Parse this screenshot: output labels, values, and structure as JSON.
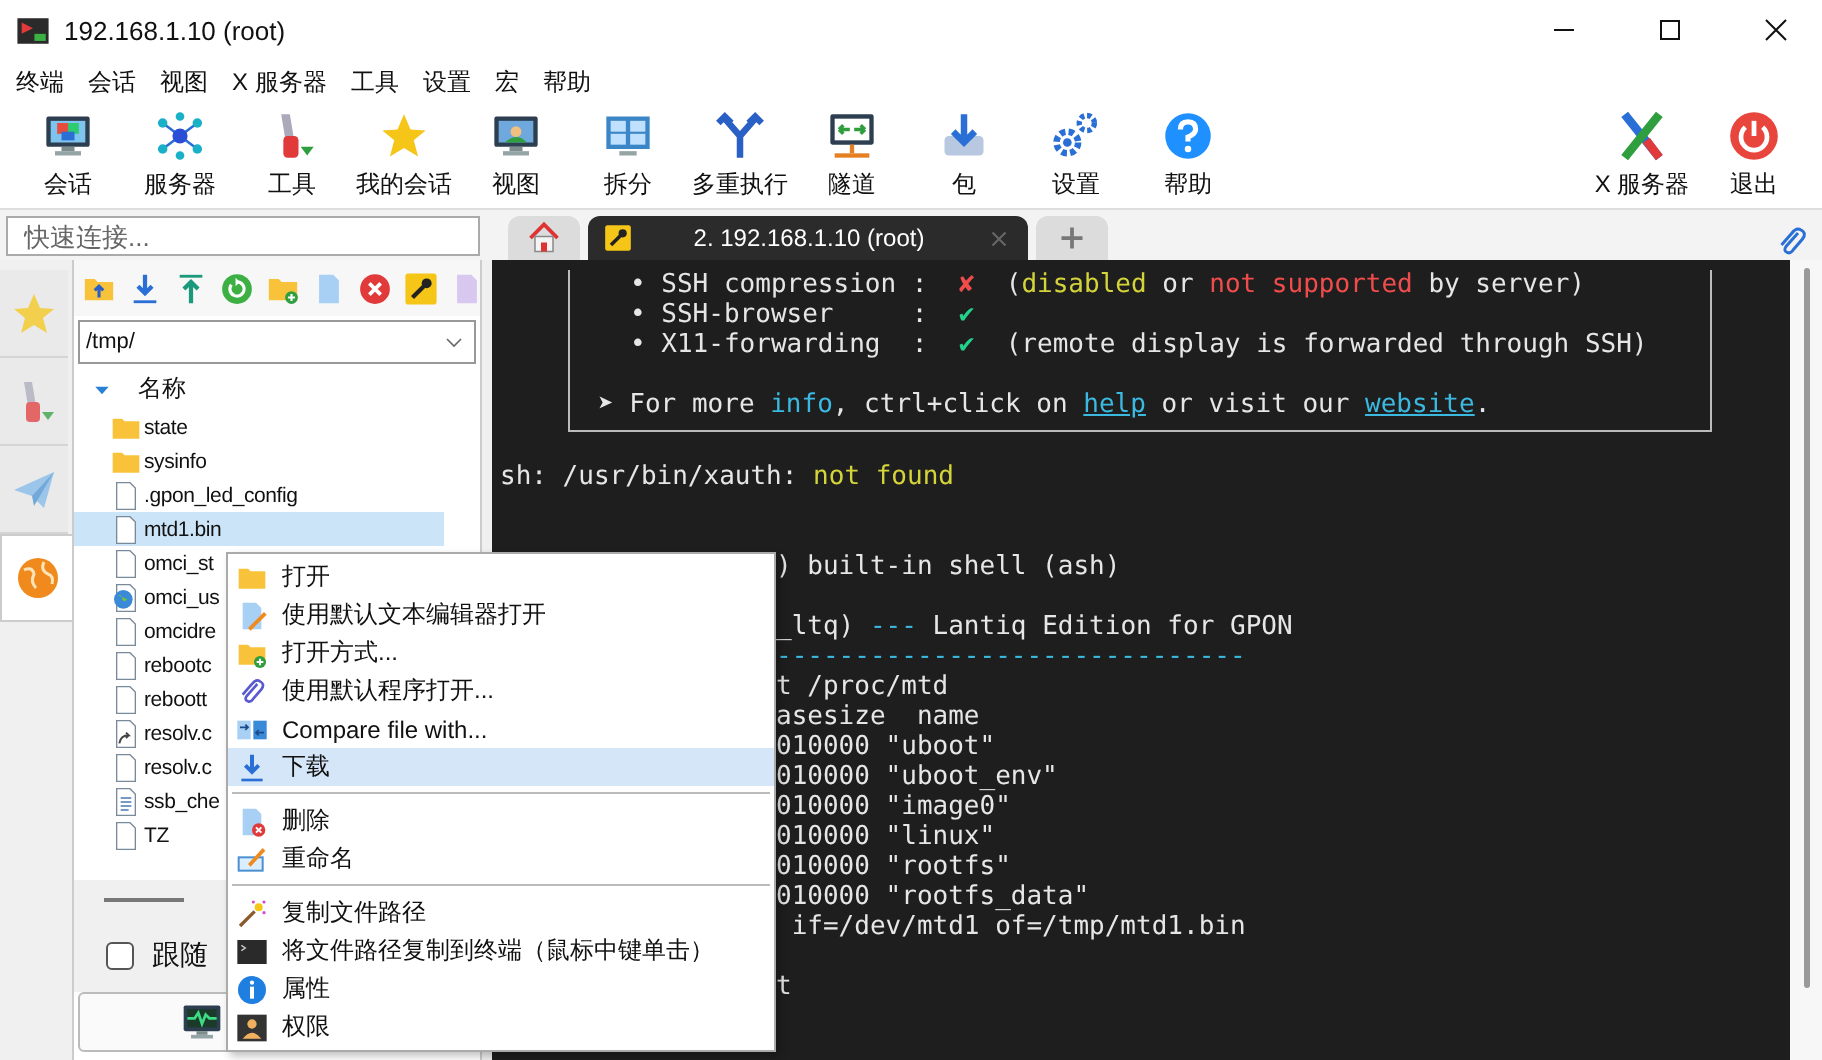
{
  "window": {
    "title": "192.168.1.10 (root)"
  },
  "menu_bar": [
    "终端",
    "会话",
    "视图",
    "X 服务器",
    "工具",
    "设置",
    "宏",
    "帮助"
  ],
  "toolbar": {
    "left": [
      {
        "kind": "session",
        "label": "会话"
      },
      {
        "kind": "servers",
        "label": "服务器"
      },
      {
        "kind": "tools",
        "label": "工具"
      },
      {
        "kind": "star",
        "label": "我的会话"
      },
      {
        "kind": "view",
        "label": "视图"
      },
      {
        "kind": "split",
        "label": "拆分"
      },
      {
        "kind": "fork",
        "label": "多重执行"
      },
      {
        "kind": "tunnel",
        "label": "隧道"
      },
      {
        "kind": "package",
        "label": "包"
      },
      {
        "kind": "settings",
        "label": "设置"
      },
      {
        "kind": "help",
        "label": "帮助"
      }
    ],
    "right": [
      {
        "kind": "xserver",
        "label": "X 服务器"
      },
      {
        "kind": "exit",
        "label": "退出"
      }
    ]
  },
  "quick_connect": {
    "placeholder": "快速连接..."
  },
  "tabs": [
    {
      "kind": "home",
      "selected": false
    },
    {
      "kind": "session",
      "label": "2. 192.168.1.10 (root)",
      "selected": true
    },
    {
      "kind": "new",
      "selected": false
    }
  ],
  "side_tabs": [
    {
      "kind": "star",
      "selected": false
    },
    {
      "kind": "tools",
      "selected": false
    },
    {
      "kind": "send",
      "selected": false
    },
    {
      "kind": "globe",
      "selected": true
    }
  ],
  "file_panel": {
    "toolbar": [
      {
        "kind": "folderup"
      },
      {
        "kind": "download"
      },
      {
        "kind": "upload"
      },
      {
        "kind": "refresh"
      },
      {
        "kind": "newfolder"
      },
      {
        "kind": "newfile"
      },
      {
        "kind": "delete"
      },
      {
        "kind": "key"
      },
      {
        "kind": "page"
      }
    ],
    "path": "/tmp/",
    "header": {
      "label": "名称",
      "expanded": true
    },
    "files": [
      {
        "name": "state",
        "kind": "folder",
        "selected": false
      },
      {
        "name": "sysinfo",
        "kind": "folder",
        "selected": false
      },
      {
        "name": ".gpon_led_config",
        "kind": "file",
        "selected": false
      },
      {
        "name": "mtd1.bin",
        "kind": "file",
        "selected": true
      },
      {
        "name": "omci_st",
        "kind": "file",
        "selected": false
      },
      {
        "name": "omci_us",
        "kind": "web",
        "selected": false
      },
      {
        "name": "omcidre",
        "kind": "file",
        "selected": false
      },
      {
        "name": "rebootc",
        "kind": "file",
        "selected": false
      },
      {
        "name": "reboott",
        "kind": "file",
        "selected": false
      },
      {
        "name": "resolv.c",
        "kind": "shortcut",
        "selected": false
      },
      {
        "name": "resolv.c",
        "kind": "file",
        "selected": false
      },
      {
        "name": "ssb_che",
        "kind": "text",
        "selected": false
      },
      {
        "name": "TZ",
        "kind": "file",
        "selected": false
      }
    ],
    "follow": {
      "label": "跟随",
      "checked": false
    }
  },
  "context_menu": {
    "sections": [
      [
        {
          "kind": "open",
          "label": "打开",
          "selected": false
        },
        {
          "kind": "editor",
          "label": "使用默认文本编辑器打开",
          "selected": false
        },
        {
          "kind": "openwith",
          "label": "打开方式...",
          "selected": false
        },
        {
          "kind": "default",
          "label": "使用默认程序打开...",
          "selected": false
        },
        {
          "kind": "compare",
          "label": "Compare file with...",
          "selected": false
        },
        {
          "kind": "download",
          "label": "下载",
          "selected": true
        }
      ],
      [
        {
          "kind": "delete",
          "label": "删除",
          "selected": false
        },
        {
          "kind": "rename",
          "label": "重命名",
          "selected": false
        }
      ],
      [
        {
          "kind": "copypath",
          "label": "复制文件路径",
          "selected": false
        },
        {
          "kind": "copyterm",
          "label": "将文件路径复制到终端（鼠标中键单击）",
          "selected": false
        },
        {
          "kind": "props",
          "label": "属性",
          "selected": false
        },
        {
          "kind": "perms",
          "label": "权限",
          "selected": false
        }
      ]
    ]
  },
  "terminal": {
    "banner": [
      {
        "kind": "bullet",
        "segments": [
          {
            "kind": "text",
            "text": "• SSH compression :  "
          },
          {
            "kind": "error",
            "text": "✘"
          },
          {
            "kind": "text",
            "text": "  ("
          },
          {
            "kind": "warn",
            "text": "disabled"
          },
          {
            "kind": "text",
            "text": " or "
          },
          {
            "kind": "error",
            "text": "not supported"
          },
          {
            "kind": "text",
            "text": " by server)"
          }
        ]
      },
      {
        "kind": "bullet",
        "segments": [
          {
            "kind": "text",
            "text": "• SSH-browser     :  "
          },
          {
            "kind": "ok",
            "text": "✔"
          }
        ]
      },
      {
        "kind": "bullet",
        "segments": [
          {
            "kind": "text",
            "text": "• X11-forwarding  :  "
          },
          {
            "kind": "ok",
            "text": "✔"
          },
          {
            "kind": "text",
            "text": "  (remote display is forwarded through SSH)"
          }
        ]
      },
      {
        "kind": "blank"
      },
      {
        "kind": "note",
        "segments": [
          {
            "kind": "text",
            "text": "➤ For more "
          },
          {
            "kind": "info",
            "text": "info"
          },
          {
            "kind": "text",
            "text": ", ctrl+click on "
          },
          {
            "kind": "link",
            "text": "help"
          },
          {
            "kind": "text",
            "text": " or visit our "
          },
          {
            "kind": "link",
            "text": "website"
          },
          {
            "kind": "text",
            "text": "."
          }
        ]
      }
    ],
    "lines": [
      {
        "kind": "blank"
      },
      {
        "kind": "full",
        "segments": [
          {
            "kind": "text",
            "text": "sh: /usr/bin/xauth: "
          },
          {
            "kind": "warn",
            "text": "not found"
          }
        ]
      },
      {
        "kind": "blank"
      },
      {
        "kind": "blank"
      },
      {
        "kind": "partial",
        "segments": [
          {
            "kind": "text",
            "text": ") built-in shell (ash)"
          }
        ]
      },
      {
        "kind": "blank"
      },
      {
        "kind": "partial",
        "segments": [
          {
            "kind": "text",
            "text": "_ltq) "
          },
          {
            "kind": "info",
            "text": "---"
          },
          {
            "kind": "text",
            "text": " Lantiq Edition for GPON"
          }
        ]
      },
      {
        "kind": "partial",
        "segments": [
          {
            "kind": "info",
            "text": "------------------------------"
          }
        ]
      },
      {
        "kind": "partial",
        "segments": [
          {
            "kind": "text",
            "text": "t /proc/mtd"
          }
        ]
      },
      {
        "kind": "partial",
        "segments": [
          {
            "kind": "text",
            "text": "asesize  name"
          }
        ]
      },
      {
        "kind": "partial",
        "segments": [
          {
            "kind": "text",
            "text": "010000 \"uboot\""
          }
        ]
      },
      {
        "kind": "partial",
        "segments": [
          {
            "kind": "text",
            "text": "010000 \"uboot_env\""
          }
        ]
      },
      {
        "kind": "partial",
        "segments": [
          {
            "kind": "text",
            "text": "010000 \"image0\""
          }
        ]
      },
      {
        "kind": "partial",
        "segments": [
          {
            "kind": "text",
            "text": "010000 \"linux\""
          }
        ]
      },
      {
        "kind": "partial",
        "segments": [
          {
            "kind": "text",
            "text": "010000 \"rootfs\""
          }
        ]
      },
      {
        "kind": "partial",
        "segments": [
          {
            "kind": "text",
            "text": "010000 \"rootfs_data\""
          }
        ]
      },
      {
        "kind": "partial",
        "segments": [
          {
            "kind": "text",
            "text": " if=/dev/mtd1 of=/tmp/mtd1.bin"
          }
        ]
      },
      {
        "kind": "blank"
      },
      {
        "kind": "partial",
        "segments": [
          {
            "kind": "text",
            "text": "t"
          }
        ]
      }
    ]
  }
}
